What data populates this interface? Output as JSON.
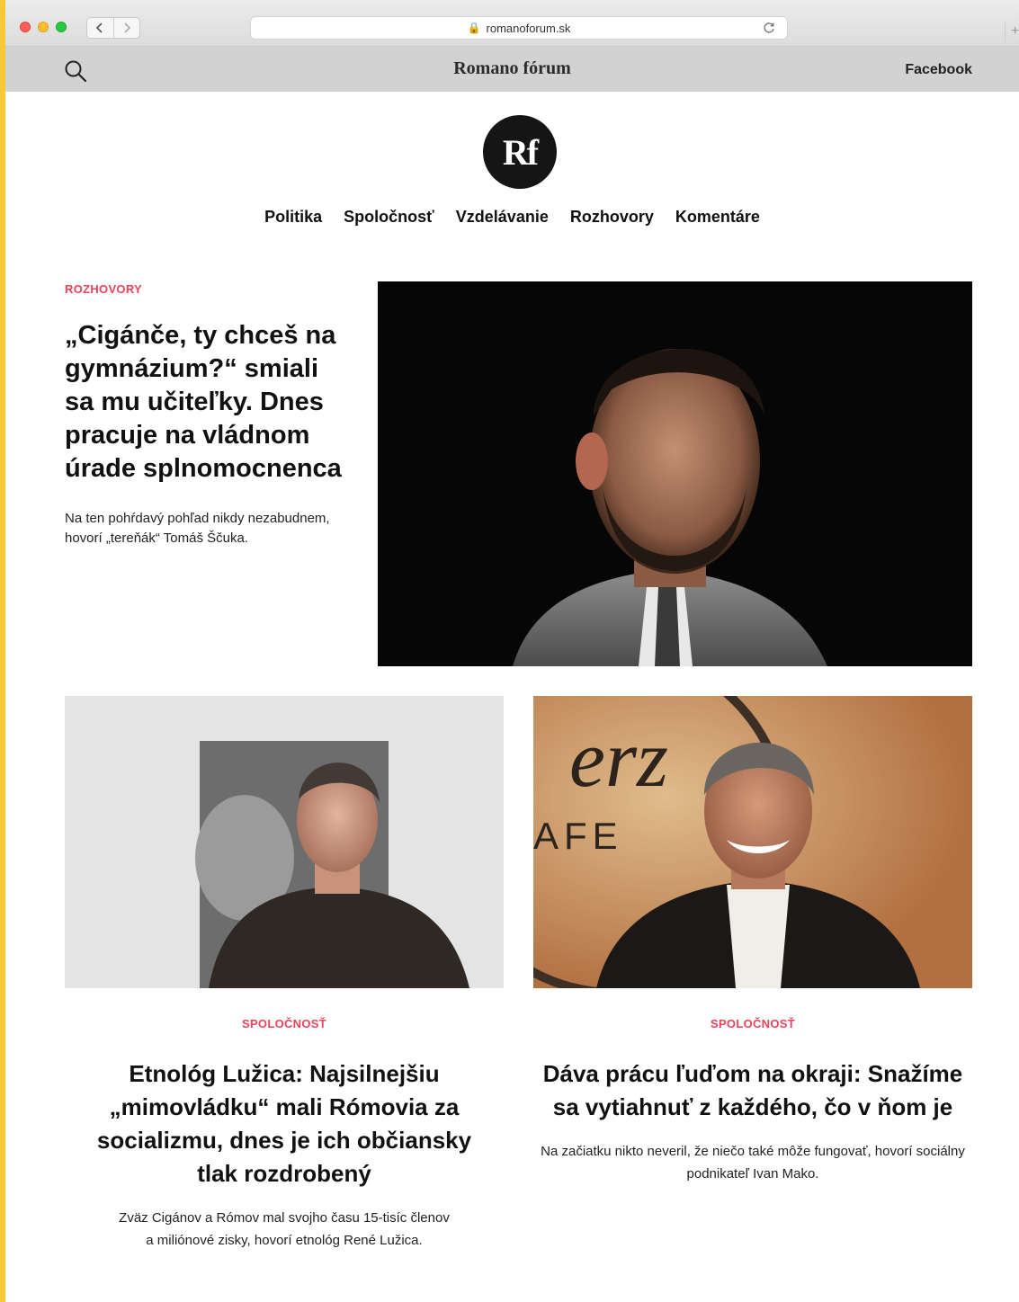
{
  "browser": {
    "url": "romanoforum.sk"
  },
  "header": {
    "site_title": "Romano fórum",
    "facebook_link": "Facebook",
    "logo_text": "Rf"
  },
  "nav": {
    "items": [
      {
        "label": "Politika"
      },
      {
        "label": "Spoločnosť"
      },
      {
        "label": "Vzdelávanie"
      },
      {
        "label": "Rozhovory"
      },
      {
        "label": "Komentáre"
      }
    ]
  },
  "featured": {
    "category": "ROZHOVORY",
    "title": "„Cigánče, ty chceš na gymnázium?“ smiali sa mu učiteľky. Dnes pracuje na vládnom úrade splnomocnenca",
    "lead": "Na ten pohŕdavý pohľad nikdy nezabudnem, hovorí „tereňák“ Tomáš Ščuka."
  },
  "articles": [
    {
      "category": "SPOLOČNOSŤ",
      "title": "Etnológ Lužica: Najsilnejšiu „mimovládku“ mali Rómovia za socializmu, dnes je ich občiansky tlak rozdrobený",
      "lead": "Zväz Cigánov a Rómov mal svojho času 15-tisíc členov a miliónové zisky, hovorí etnológ René Lužica."
    },
    {
      "category": "SPOLOČNOSŤ",
      "title": "Dáva prácu ľuďom na okraji: Snažíme sa vytiahnuť z každého, čo v ňom je",
      "lead": "Na začiatku nikto neveril, že niečo také môže fungovať, hovorí sociálny podnikateľ Ivan Mako."
    }
  ],
  "colors": {
    "accent": "#e8445a",
    "header_bar": "#d2d2d2",
    "background_frame": "#f5c93a"
  },
  "icons": {
    "search": "search-icon",
    "lock": "lock-icon",
    "reload": "reload-icon"
  }
}
